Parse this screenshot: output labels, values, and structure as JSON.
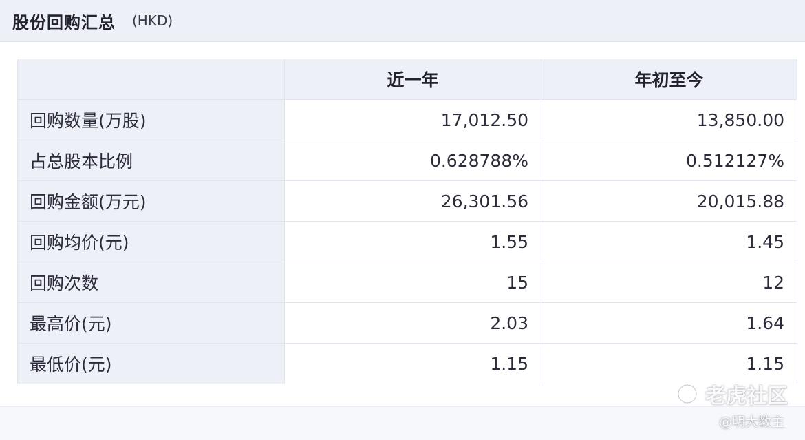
{
  "header": {
    "title": "股份回购汇总",
    "currency": "(HKD)"
  },
  "table": {
    "columns": [
      "",
      "近一年",
      "年初至今"
    ],
    "rows": [
      {
        "label": "回购数量(万股)",
        "last_year": "17,012.50",
        "ytd": "13,850.00"
      },
      {
        "label": "占总股本比例",
        "last_year": "0.628788%",
        "ytd": "0.512127%"
      },
      {
        "label": "回购金额(万元)",
        "last_year": "26,301.56",
        "ytd": "20,015.88"
      },
      {
        "label": "回购均价(元)",
        "last_year": "1.55",
        "ytd": "1.45"
      },
      {
        "label": "回购次数",
        "last_year": "15",
        "ytd": "12"
      },
      {
        "label": "最高价(元)",
        "last_year": "2.03",
        "ytd": "1.64"
      },
      {
        "label": "最低价(元)",
        "last_year": "1.15",
        "ytd": "1.15"
      }
    ]
  },
  "watermark": {
    "brand": "老虎社区",
    "author": "@明大教主",
    "logo_icon": "tiger-logo-icon"
  }
}
